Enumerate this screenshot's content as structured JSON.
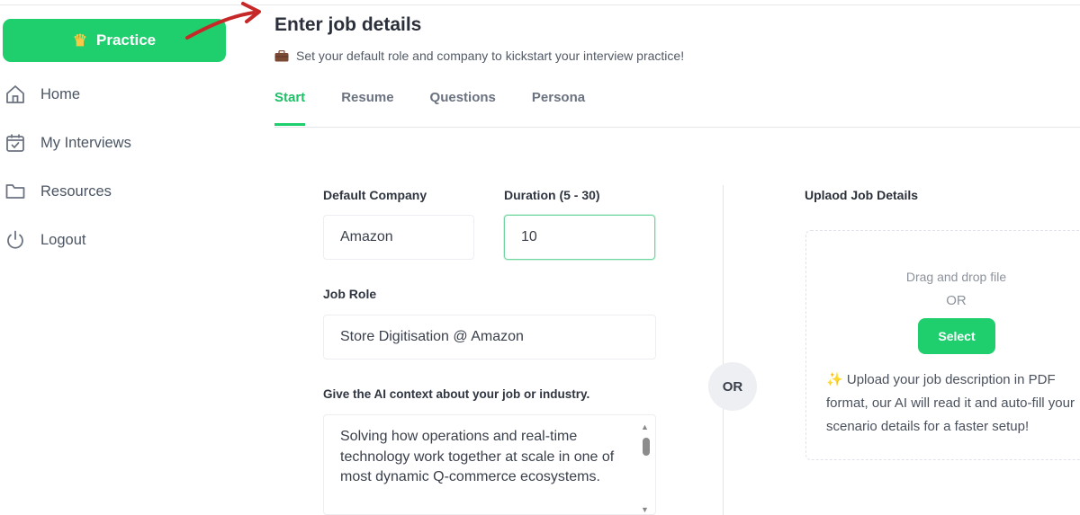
{
  "sidebar": {
    "practice_label": "Practice",
    "items": [
      {
        "label": "Home",
        "icon": "home-icon"
      },
      {
        "label": "My Interviews",
        "icon": "calendar-check-icon"
      },
      {
        "label": "Resources",
        "icon": "folder-icon"
      },
      {
        "label": "Logout",
        "icon": "power-icon"
      }
    ]
  },
  "header": {
    "title": "Enter job details",
    "subtitle": "Set your default role and company to kickstart your interview practice!"
  },
  "tabs": [
    {
      "label": "Start",
      "active": true
    },
    {
      "label": "Resume",
      "active": false
    },
    {
      "label": "Questions",
      "active": false
    },
    {
      "label": "Persona",
      "active": false
    }
  ],
  "form": {
    "company_label": "Default Company",
    "company_value": "Amazon",
    "duration_label": "Duration (5 - 30)",
    "duration_value": "10",
    "role_label": "Job Role",
    "role_value": "Store Digitisation @ Amazon",
    "context_label": "Give the AI context about your job or industry.",
    "context_value": "Solving how operations and real-time technology work together at scale in one of most dynamic Q-commerce ecosystems."
  },
  "or_label": "OR",
  "upload": {
    "title": "Uplaod Job Details",
    "drag_text": "Drag and drop file",
    "or_text": "OR",
    "select_label": "Select",
    "description": "Upload your job description in PDF format, our AI will read it and auto-fill your scenario details for a faster setup!"
  },
  "colors": {
    "accent": "#1fcf6e",
    "arrow": "#c62828"
  }
}
